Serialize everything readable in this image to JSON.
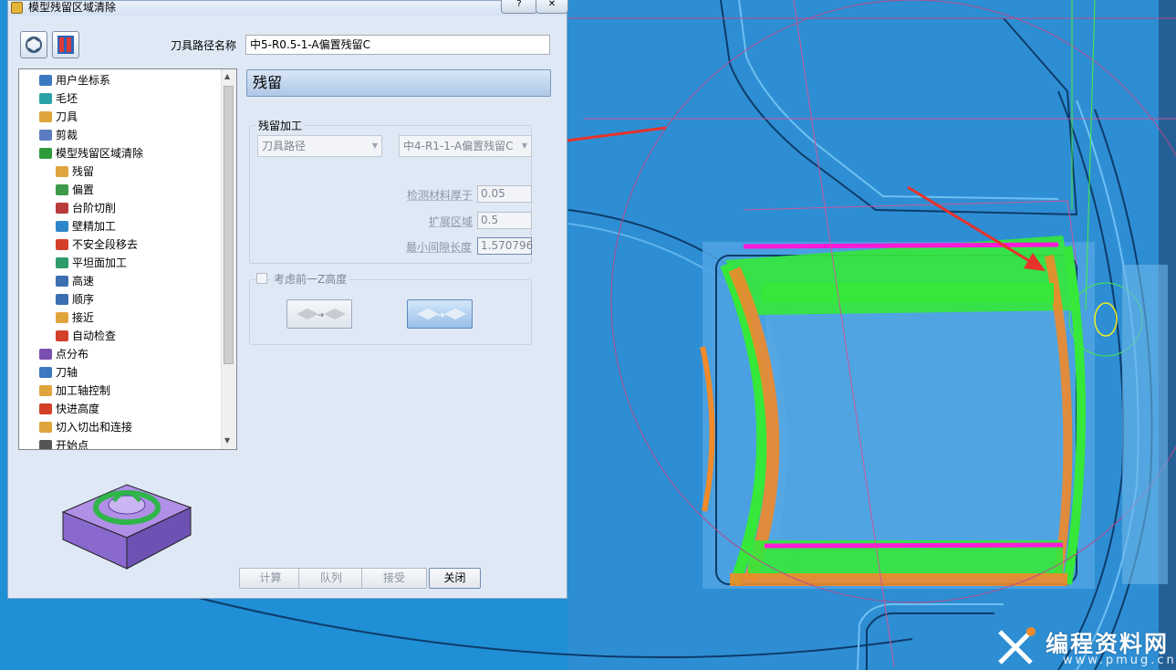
{
  "window": {
    "title": "模型残留区域清除",
    "help_symbol": "?",
    "close_symbol": "✕"
  },
  "header": {
    "path_name_label": "刀具路径名称",
    "path_name_value": "中5-R0.5-1-A偏置残留C"
  },
  "tree": {
    "items": [
      {
        "label": "用户坐标系",
        "icon": "ucs-icon",
        "level": 1,
        "color": "#3a78c2"
      },
      {
        "label": "毛坯",
        "icon": "block-icon",
        "level": 1,
        "color": "#2aa3a8"
      },
      {
        "label": "刀具",
        "icon": "tool-icon",
        "level": 1,
        "color": "#e0a43c"
      },
      {
        "label": "剪裁",
        "icon": "trim-icon",
        "level": 1,
        "color": "#5b7cc1"
      },
      {
        "label": "模型残留区域清除",
        "icon": "model-rest-icon",
        "level": 1,
        "color": "#2f9a3a"
      },
      {
        "label": "残留",
        "icon": "rest-icon",
        "level": 2,
        "color": "#e0a43c"
      },
      {
        "label": "偏置",
        "icon": "offset-icon",
        "level": 2,
        "color": "#3e9a4a"
      },
      {
        "label": "台阶切削",
        "icon": "step-icon",
        "level": 2,
        "color": "#b83a3a"
      },
      {
        "label": "壁精加工",
        "icon": "wall-finish-icon",
        "level": 2,
        "color": "#2d86c9"
      },
      {
        "label": "不安全段移去",
        "icon": "unsafe-icon",
        "level": 2,
        "color": "#d2402a"
      },
      {
        "label": "平坦面加工",
        "icon": "flat-icon",
        "level": 2,
        "color": "#2f9a6a"
      },
      {
        "label": "高速",
        "icon": "highspeed-icon",
        "level": 2,
        "color": "#3b6fb0"
      },
      {
        "label": "顺序",
        "icon": "order-icon",
        "level": 2,
        "color": "#3b6fb0"
      },
      {
        "label": "接近",
        "icon": "approach-icon",
        "level": 2,
        "color": "#e0a43c"
      },
      {
        "label": "自动检查",
        "icon": "autocheck-icon",
        "level": 2,
        "color": "#d2402a"
      },
      {
        "label": "点分布",
        "icon": "point-icon",
        "level": 1,
        "color": "#7a4fb0"
      },
      {
        "label": "刀轴",
        "icon": "axis-icon",
        "level": 1,
        "color": "#3a78c2"
      },
      {
        "label": "加工轴控制",
        "icon": "axis-control-icon",
        "level": 1,
        "color": "#e0a43c"
      },
      {
        "label": "快进高度",
        "icon": "rapid-icon",
        "level": 1,
        "color": "#d2402a"
      },
      {
        "label": "切入切出和连接",
        "icon": "leads-icon",
        "level": 1,
        "color": "#e0a43c"
      },
      {
        "label": "开始点",
        "icon": "start-icon",
        "level": 1,
        "color": "#555555"
      }
    ]
  },
  "section": {
    "title": "残留"
  },
  "residual": {
    "group_label": "残留加工",
    "tool_path_combo": "刀具路径",
    "ref_path_combo": "中4-R1-1-A偏置残留C",
    "detect_label": "检测材料厚于",
    "detect_value": "0.05",
    "expand_label": "扩展区域",
    "expand_value": "0.5",
    "min_gap_label": "最小间隙长度",
    "min_gap_value": "1.570796"
  },
  "zgroup": {
    "label": "考虑前一Z高度"
  },
  "buttons": {
    "calc": "计算",
    "queue": "队列",
    "accept": "接受",
    "close": "关闭"
  },
  "watermark": {
    "name": "编程资料网",
    "url": "www.pmug.cn"
  },
  "colors": {
    "viewport_bg": "#1f8fd6",
    "toolpath_green": "#35e83a",
    "toolpath_orange": "#f08a2a",
    "toolpath_magenta": "#ff1ad8",
    "arrow_red": "#e8322a"
  }
}
